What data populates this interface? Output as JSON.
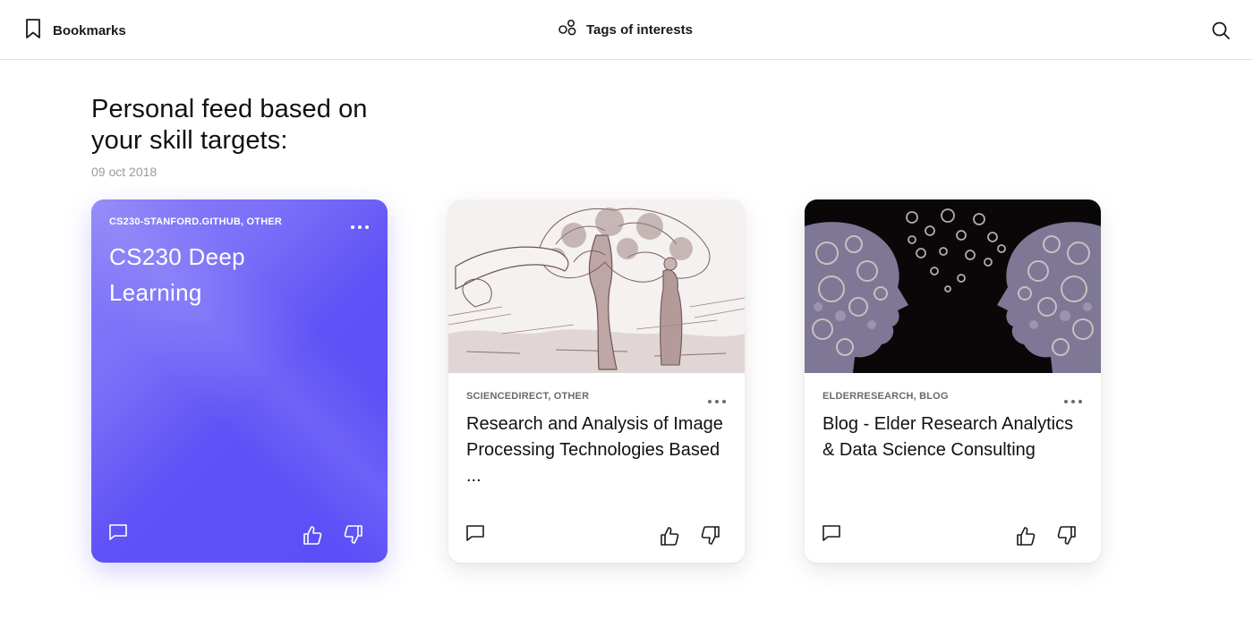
{
  "topbar": {
    "bookmarks_label": "Bookmarks",
    "bookmarks_icon": "bookmark-icon",
    "tags_label": "Tags of interests",
    "tags_icon": "tags-icon",
    "search_icon": "search-icon"
  },
  "page": {
    "title": "Personal feed based on your skill targets:",
    "date": "09 oct 2018"
  },
  "cards": [
    {
      "source": "CS230-STANFORD.GITHUB, OTHER",
      "title": "CS230 Deep Learning",
      "color": "#5f52f6"
    },
    {
      "source": "SCIENCEDIRECT, OTHER",
      "title": "Research and Analysis of Image Processing Technologies Based ...",
      "image": "engraving of a tree with a ribbon banner"
    },
    {
      "source": "ELDERRESEARCH, BLOG",
      "title": "Blog - Elder Research Analytics & Data Science Consulting",
      "image": "two head silhouettes filled with gears"
    }
  ],
  "icons": {
    "more": "more-dots-icon",
    "comment": "comment-icon",
    "like": "thumbs-up-icon",
    "dislike": "thumbs-down-icon"
  },
  "colors": {
    "accent": "#5f52f6",
    "text": "#111111",
    "muted": "#9a9a9a"
  }
}
